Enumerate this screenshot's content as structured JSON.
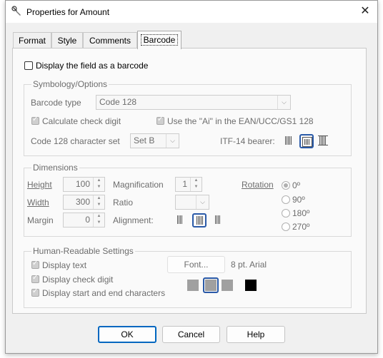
{
  "window": {
    "title": "Properties for Amount"
  },
  "tabs": [
    {
      "label": "Format"
    },
    {
      "label": "Style"
    },
    {
      "label": "Comments"
    },
    {
      "label": "Barcode"
    }
  ],
  "barcode": {
    "display_label": "Display the field as a barcode",
    "symbology": {
      "legend": "Symbology/Options",
      "type_label": "Barcode type",
      "type_value": "Code 128",
      "calc_check_label": "Calculate check digit",
      "ai_label": "Use the \"Ai\" in the EAN/UCC/GS1 128",
      "charset_label": "Code 128 character set",
      "charset_value": "Set B",
      "itf_label": "ITF-14 bearer:"
    },
    "dimensions": {
      "legend": "Dimensions",
      "height_label": "Height",
      "height_value": "100",
      "width_label": "Width",
      "width_value": "300",
      "margin_label": "Margin",
      "margin_value": "0",
      "magnification_label": "Magnification",
      "magnification_value": "1",
      "ratio_label": "Ratio",
      "ratio_value": "",
      "alignment_label": "Alignment:",
      "rotation_label": "Rotation",
      "rotation_options": [
        "0º",
        "90º",
        "180º",
        "270º"
      ]
    },
    "human": {
      "legend": "Human-Readable Settings",
      "display_text_label": "Display text",
      "display_check_label": "Display check digit",
      "display_start_end_label": "Display start and end characters",
      "font_button": "Font...",
      "font_value": "8 pt. Arial"
    }
  },
  "buttons": {
    "ok": "OK",
    "cancel": "Cancel",
    "help": "Help"
  },
  "colors": {
    "accent": "#0067c0",
    "selected_border": "#2a5aa8"
  }
}
